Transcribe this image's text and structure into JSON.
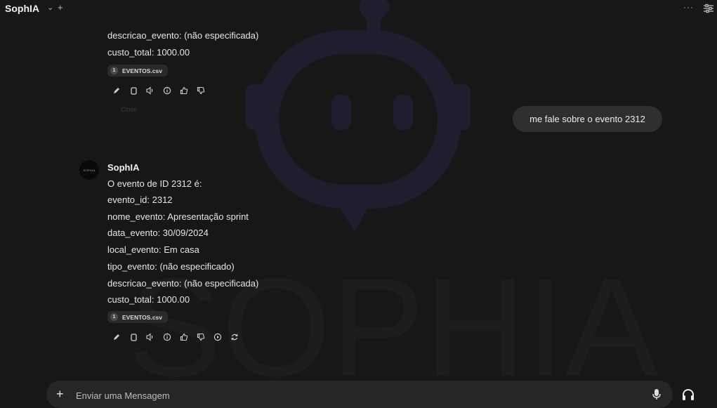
{
  "app": {
    "title": "SophIA"
  },
  "watermark_text": "SOPHIA",
  "previous_message": {
    "lines": [
      "descricao_evento: (não especificada)",
      "custo_total: 1000.00"
    ],
    "citation": {
      "index": "1",
      "file": "EVENTOS.csv"
    },
    "faded_text": "Close"
  },
  "user_message": {
    "text": "me fale sobre o evento 2312"
  },
  "bot_message": {
    "name": "SophIA",
    "avatar_text": "SOPHIA",
    "lines": [
      "O evento de ID 2312 é:",
      "evento_id: 2312",
      "nome_evento: Apresentação sprint",
      "data_evento: 30/09/2024",
      "local_evento: Em casa",
      "tipo_evento: (não especificado)",
      "descricao_evento: (não especificada)",
      "custo_total: 1000.00"
    ],
    "citation": {
      "index": "1",
      "file": "EVENTOS.csv"
    }
  },
  "composer": {
    "placeholder": "Enviar uma Mensagem"
  },
  "header": {
    "more": "···"
  }
}
